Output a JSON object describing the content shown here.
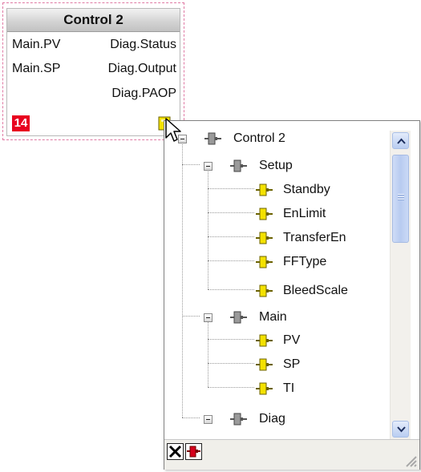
{
  "block": {
    "title": "Control 2",
    "inputs": [
      "Main.PV",
      "Main.SP"
    ],
    "outputs": [
      "Diag.Status",
      "Diag.Output",
      "Diag.PAOP"
    ],
    "number": "14"
  },
  "tree": {
    "root": "Control 2",
    "groups": [
      {
        "label": "Setup",
        "items": [
          "Standby",
          "EnLimit",
          "TransferEn",
          "FFType",
          "BleedScale"
        ]
      },
      {
        "label": "Main",
        "items": [
          "PV",
          "SP",
          "TI"
        ]
      },
      {
        "label": "Diag",
        "items": []
      }
    ]
  },
  "colors": {
    "accent_red": "#e8001f",
    "connector_yellow": "#f4e200",
    "connector_grey": "#8c8c8c",
    "selection_dash": "#e07aa4"
  },
  "icons": {
    "close": "close-x-icon",
    "disconnect": "red-connector-icon",
    "resize": "resize-grip-icon"
  }
}
